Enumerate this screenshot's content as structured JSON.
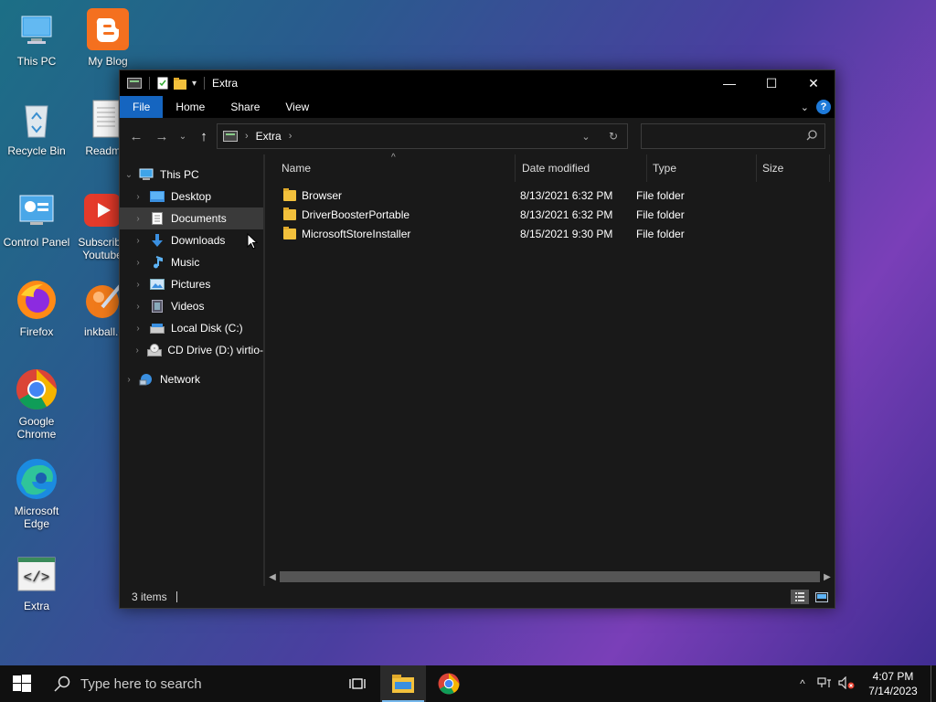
{
  "desktop": {
    "icons": [
      {
        "label": "This PC",
        "icon": "this-pc-icon"
      },
      {
        "label": "My Blog",
        "icon": "blogger-icon"
      },
      {
        "label": "Recycle Bin",
        "icon": "recycle-bin-icon"
      },
      {
        "label": "Readme",
        "icon": "text-file-icon"
      },
      {
        "label": "Control Panel",
        "icon": "control-panel-icon"
      },
      {
        "label": "Subscribe Youtube",
        "icon": "youtube-icon"
      },
      {
        "label": "Firefox",
        "icon": "firefox-icon"
      },
      {
        "label": "inkball.e",
        "icon": "inkball-icon"
      },
      {
        "label": "Google Chrome",
        "icon": "chrome-icon"
      },
      {
        "label": "Microsoft Edge",
        "icon": "edge-icon"
      },
      {
        "label": "Extra",
        "icon": "html-file-icon"
      }
    ]
  },
  "window": {
    "title": "Extra",
    "ribbon_tabs": [
      "File",
      "Home",
      "Share",
      "View"
    ],
    "help_label": "?",
    "address": {
      "crumb": "Extra"
    },
    "search": {
      "placeholder": ""
    },
    "nav": {
      "this_pc": "This PC",
      "items": [
        "Desktop",
        "Documents",
        "Downloads",
        "Music",
        "Pictures",
        "Videos",
        "Local Disk (C:)",
        "CD Drive (D:) virtio-"
      ],
      "network": "Network"
    },
    "columns": [
      "Name",
      "Date modified",
      "Type",
      "Size"
    ],
    "files": [
      {
        "name": "Browser",
        "date": "8/13/2021 6:32 PM",
        "type": "File folder"
      },
      {
        "name": "DriverBoosterPortable",
        "date": "8/13/2021 6:32 PM",
        "type": "File folder"
      },
      {
        "name": "MicrosoftStoreInstaller",
        "date": "8/15/2021 9:30 PM",
        "type": "File folder"
      }
    ],
    "status": "3 items"
  },
  "taskbar": {
    "search_placeholder": "Type here to search",
    "time": "4:07 PM",
    "date": "7/14/2023"
  },
  "colors": {
    "accent": "#1565c0",
    "folder": "#f3c13c",
    "taskbar": "#101010"
  }
}
